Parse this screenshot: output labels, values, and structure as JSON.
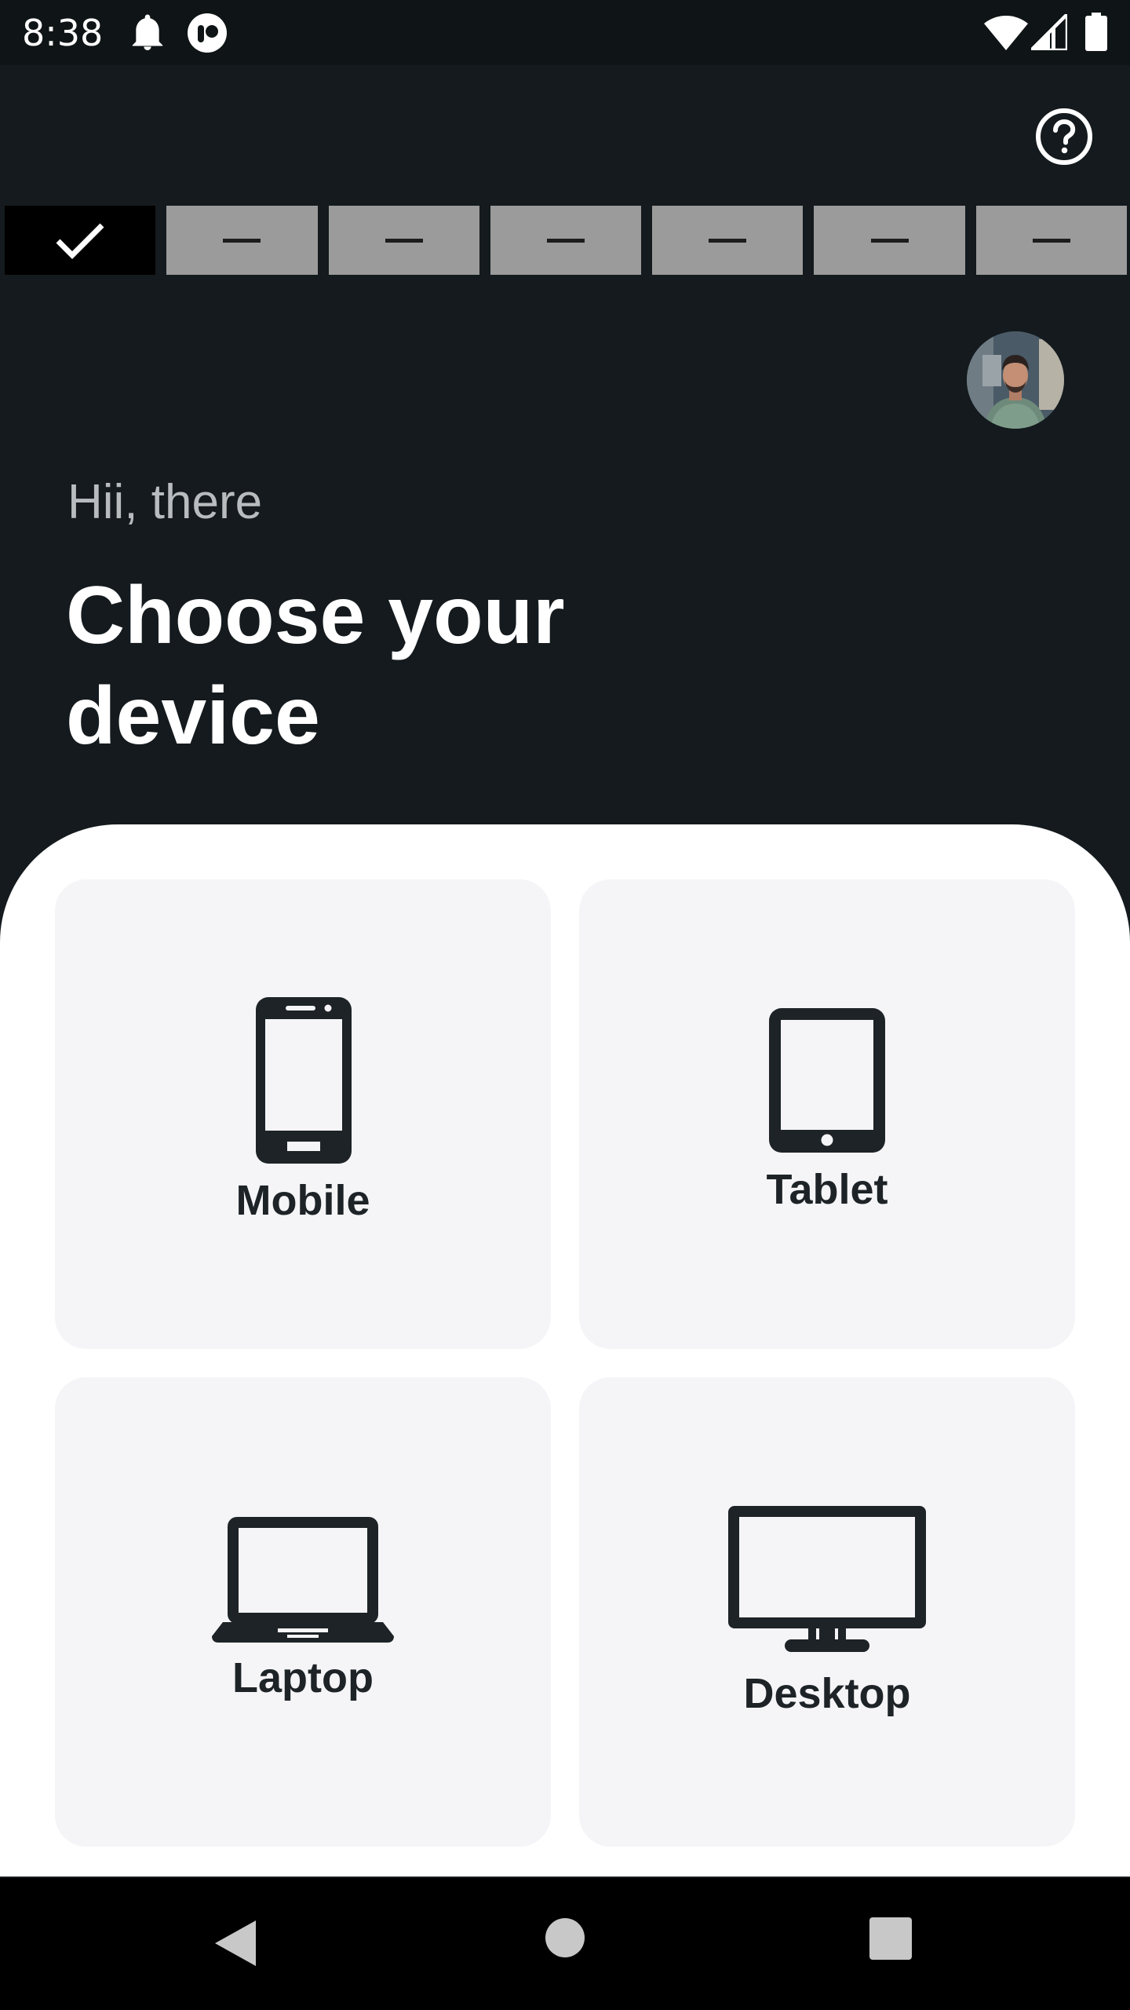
{
  "status_bar": {
    "time": "8:38",
    "icons": [
      "bell-icon",
      "app-notification-icon",
      "wifi-icon",
      "signal-icon",
      "battery-icon"
    ]
  },
  "header": {
    "help_icon": "help-circle-icon"
  },
  "stepper": {
    "total_steps": 7,
    "completed_steps": 1,
    "colors": {
      "done": "#000000",
      "pending": "#9b9b9b"
    }
  },
  "greeting": "Hii, there",
  "title": "Choose your device",
  "devices": [
    {
      "label": "Mobile",
      "icon": "mobile-phone-icon"
    },
    {
      "label": "Tablet",
      "icon": "tablet-icon"
    },
    {
      "label": "Laptop",
      "icon": "laptop-icon"
    },
    {
      "label": "Desktop",
      "icon": "desktop-monitor-icon"
    }
  ],
  "colors": {
    "background": "#141a1d",
    "sheet": "#ffffff",
    "card": "#f5f5f7",
    "text_dark": "#1d2327"
  },
  "nav_bar": {
    "buttons": [
      "back-icon",
      "home-icon",
      "recents-icon"
    ]
  }
}
